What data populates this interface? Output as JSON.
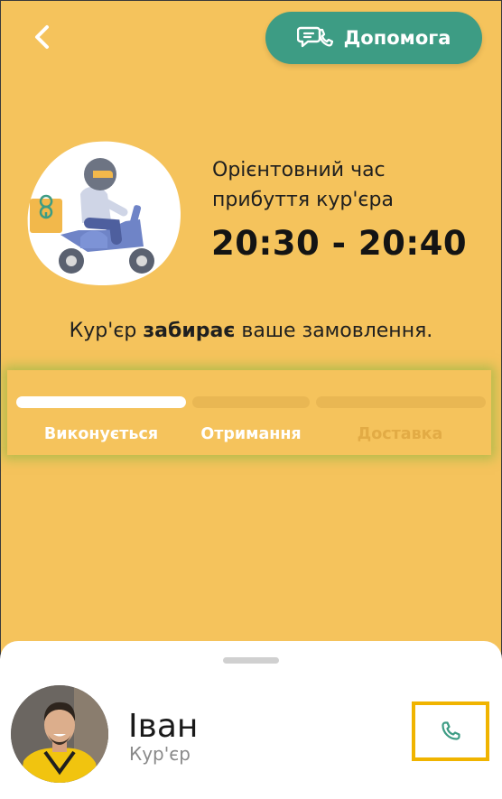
{
  "header": {
    "help_label": "Допомога"
  },
  "eta": {
    "label": "Орієнтовний час прибуття кур'єра",
    "time": "20:30 - 20:40"
  },
  "status": {
    "prefix": "Кур'єр ",
    "action": "забирає",
    "suffix": " ваше замовлення."
  },
  "progress": {
    "steps": [
      {
        "label": "Виконується",
        "state": "active",
        "fill": 1.0
      },
      {
        "label": "Отримання",
        "state": "next",
        "fill": 0.0
      },
      {
        "label": "Доставка",
        "state": "pending",
        "fill": 0.0
      }
    ]
  },
  "courier": {
    "name": "Іван",
    "role": "Кур'єр"
  },
  "colors": {
    "background": "#f5c35c",
    "accent": "#3d9c84",
    "call_highlight": "#f0b400"
  },
  "icons": {
    "back": "chevron-left-icon",
    "help": "chat-phone-icon",
    "call": "phone-icon"
  }
}
